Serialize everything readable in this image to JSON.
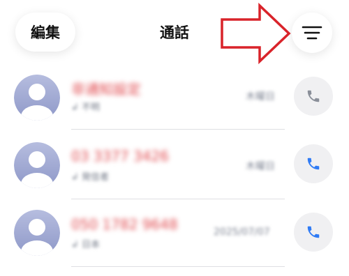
{
  "header": {
    "edit_label": "編集",
    "title": "通話",
    "filter_icon": "filter-lines-icon"
  },
  "annotation": {
    "arrow_color": "#d9232a",
    "points_to": "filter-button"
  },
  "calls": [
    {
      "name": "非通知設定",
      "subtitle": "↲ 不明",
      "time": "木曜日",
      "call_icon_color": "#8a8f99"
    },
    {
      "name": "03 3377 3426",
      "subtitle": "↲ 発信者",
      "time": "木曜日",
      "call_icon_color": "#2f7bf5"
    },
    {
      "name": "050 1782 9648",
      "subtitle": "↲ 日本",
      "time": "2025/07/07",
      "call_icon_color": "#2f7bf5"
    }
  ],
  "colors": {
    "missed_call_name": "#e0474c",
    "avatar_top": "#b6bddf",
    "avatar_bottom": "#8e98c8"
  }
}
